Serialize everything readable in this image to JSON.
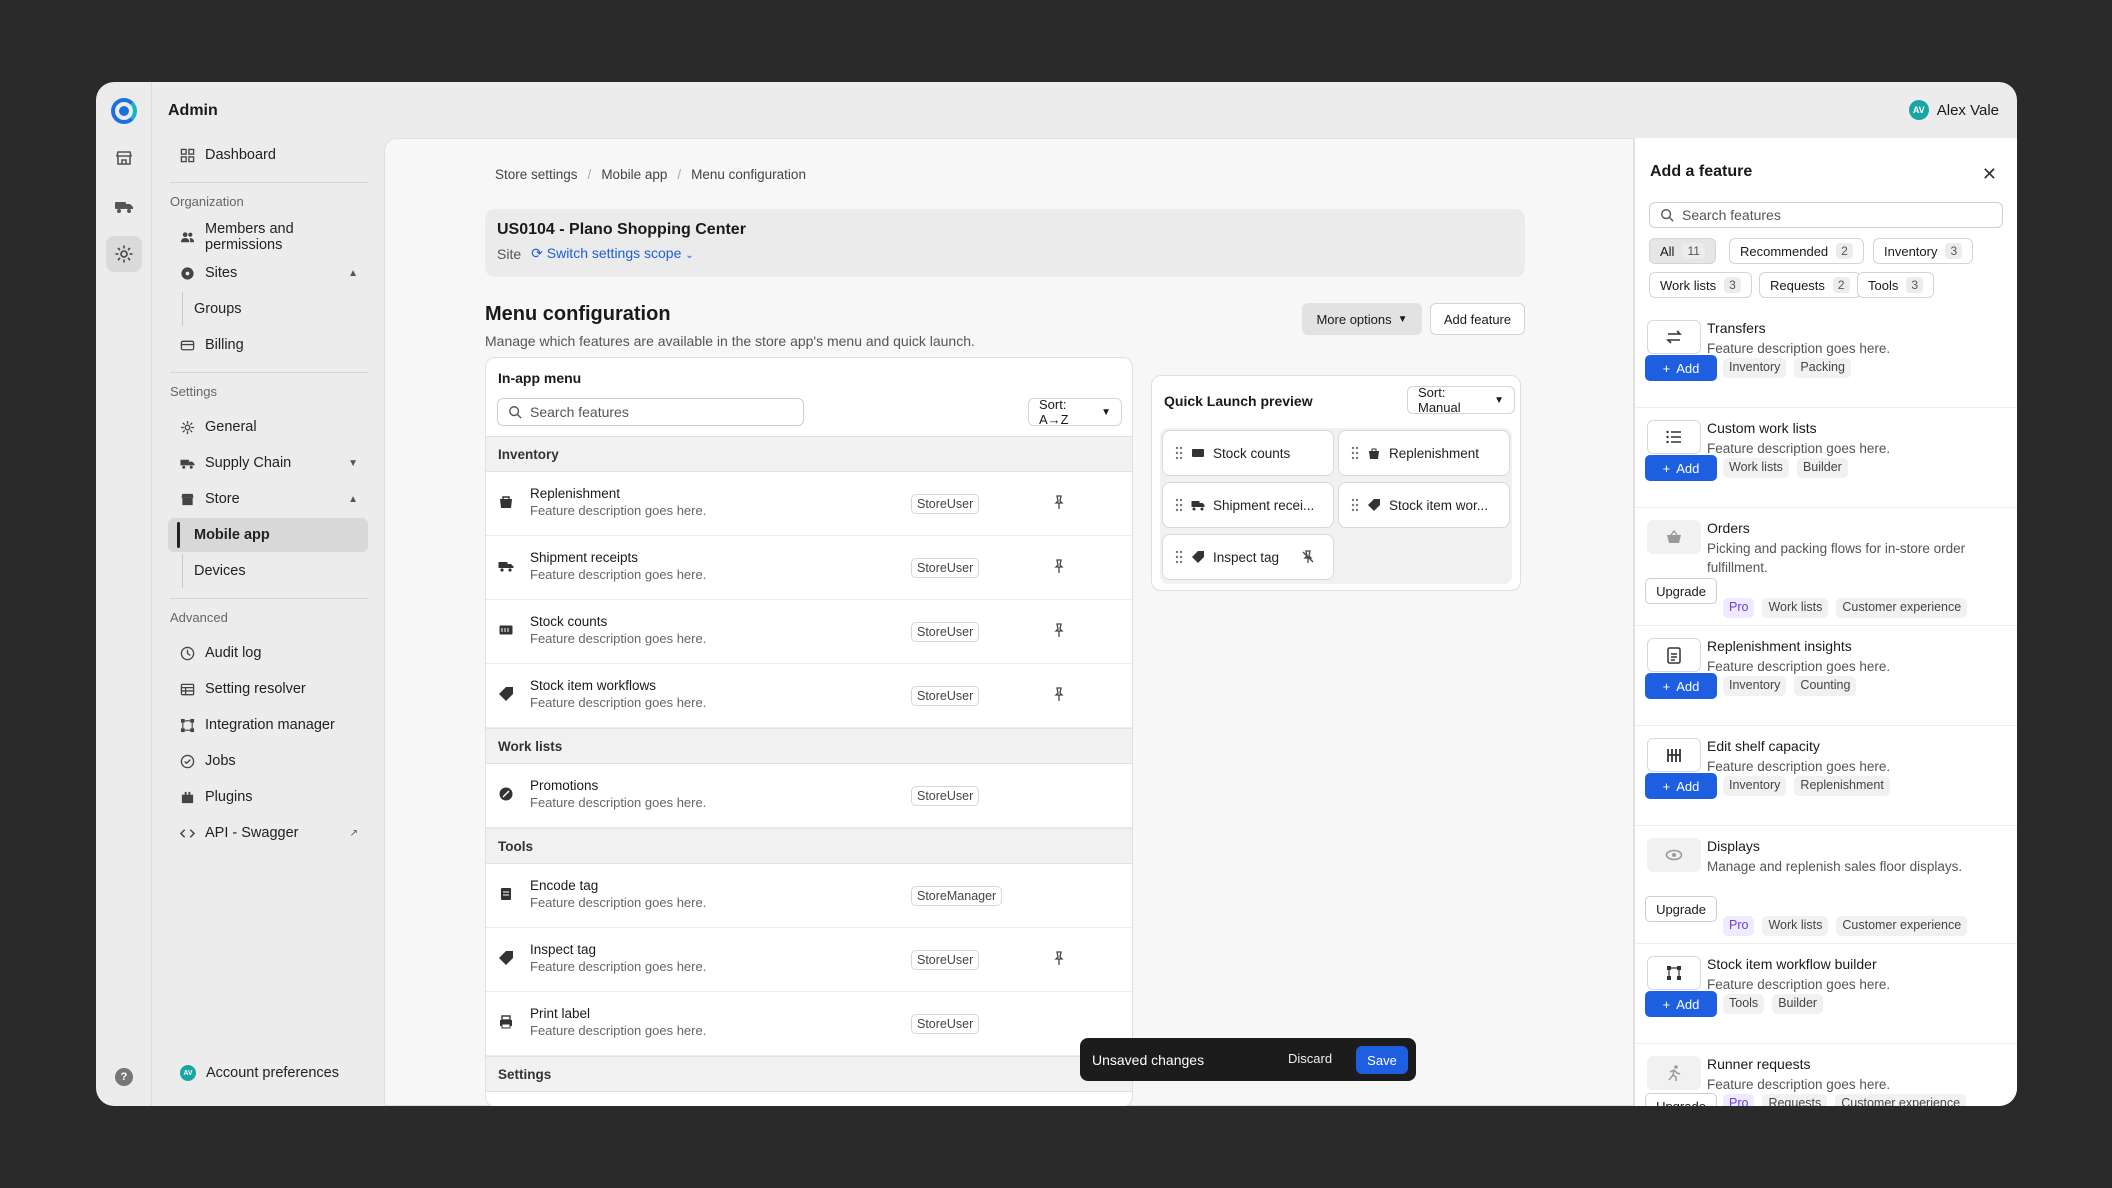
{
  "app": {
    "title": "Admin",
    "user_name": "Alex Vale",
    "user_initials": "AV"
  },
  "nav": {
    "dashboard": "Dashboard",
    "sec_org": "Organization",
    "members": "Members and permissions",
    "sites": "Sites",
    "groups": "Groups",
    "billing": "Billing",
    "sec_settings": "Settings",
    "general": "General",
    "supply_chain": "Supply Chain",
    "store": "Store",
    "mobile_app": "Mobile app",
    "devices": "Devices",
    "sec_advanced": "Advanced",
    "audit_log": "Audit log",
    "setting_resolver": "Setting resolver",
    "integration_manager": "Integration manager",
    "jobs": "Jobs",
    "plugins": "Plugins",
    "api": "API - Swagger",
    "account": "Account preferences",
    "account_initials": "AV"
  },
  "breadcrumbs": [
    "Store settings",
    "Mobile app",
    "Menu configuration"
  ],
  "scope": {
    "title": "US0104 - Plano Shopping Center",
    "label": "Site",
    "link": "Switch settings scope"
  },
  "page": {
    "title": "Menu configuration",
    "desc": "Manage which features are available in the store app's menu and quick launch.",
    "more_options": "More options",
    "add_feature": "Add feature"
  },
  "inapp": {
    "title": "In-app menu",
    "search_placeholder": "Search features",
    "sort": "Sort: A→Z",
    "sections": [
      {
        "name": "Inventory",
        "rows": [
          {
            "name": "Replenishment",
            "desc": "Feature description goes here.",
            "role": "StoreUser",
            "pinned": true
          },
          {
            "name": "Shipment receipts",
            "desc": "Feature description goes here.",
            "role": "StoreUser",
            "pinned": true
          },
          {
            "name": "Stock counts",
            "desc": "Feature description goes here.",
            "role": "StoreUser",
            "pinned": true
          },
          {
            "name": "Stock item workflows",
            "desc": "Feature description goes here.",
            "role": "StoreUser",
            "pinned": true
          }
        ]
      },
      {
        "name": "Work lists",
        "rows": [
          {
            "name": "Promotions",
            "desc": "Feature description goes here.",
            "role": "StoreUser",
            "pinned": false
          }
        ]
      },
      {
        "name": "Tools",
        "rows": [
          {
            "name": "Encode tag",
            "desc": "Feature description goes here.",
            "role": "StoreManager",
            "pinned": false
          },
          {
            "name": "Inspect tag",
            "desc": "Feature description goes here.",
            "role": "StoreUser",
            "pinned": true
          },
          {
            "name": "Print label",
            "desc": "Feature description goes here.",
            "role": "StoreUser",
            "pinned": false
          }
        ]
      },
      {
        "name": "Settings",
        "rows": []
      }
    ]
  },
  "quick_launch": {
    "title": "Quick Launch preview",
    "sort": "Sort: Manual",
    "tiles": [
      "Stock counts",
      "Replenishment",
      "Shipment recei...",
      "Stock item wor...",
      "Inspect tag"
    ]
  },
  "drawer": {
    "title": "Add a feature",
    "search_placeholder": "Search features",
    "filters": [
      {
        "label": "All",
        "count": "11"
      },
      {
        "label": "Recommended",
        "count": "2"
      },
      {
        "label": "Inventory",
        "count": "3"
      },
      {
        "label": "Work lists",
        "count": "3"
      },
      {
        "label": "Requests",
        "count": "2"
      },
      {
        "label": "Tools",
        "count": "3"
      }
    ],
    "add_label": "Add",
    "upgrade_label": "Upgrade",
    "features": [
      {
        "name": "Transfers",
        "desc": "Feature description goes here.",
        "action": "add",
        "tags": [
          "Inventory",
          "Packing"
        ]
      },
      {
        "name": "Custom work lists",
        "desc": "Feature description goes here.",
        "action": "add",
        "tags": [
          "Work lists",
          "Builder"
        ]
      },
      {
        "name": "Orders",
        "desc": "Picking and packing flows for in-store order fulfillment.",
        "action": "upgrade",
        "tags": [
          "Pro",
          "Work lists",
          "Customer experience"
        ]
      },
      {
        "name": "Replenishment insights",
        "desc": "Feature description goes here.",
        "action": "add",
        "tags": [
          "Inventory",
          "Counting"
        ]
      },
      {
        "name": "Edit shelf capacity",
        "desc": "Feature description goes here.",
        "action": "add",
        "tags": [
          "Inventory",
          "Replenishment"
        ]
      },
      {
        "name": "Displays",
        "desc": "Manage and replenish sales floor displays.",
        "action": "upgrade",
        "tags": [
          "Pro",
          "Work lists",
          "Customer experience"
        ]
      },
      {
        "name": "Stock item workflow builder",
        "desc": "Feature description goes here.",
        "action": "add",
        "tags": [
          "Tools",
          "Builder"
        ]
      },
      {
        "name": "Runner requests",
        "desc": "Feature description goes here.",
        "action": "upgrade",
        "tags": [
          "Pro",
          "Requests",
          "Customer experience"
        ]
      }
    ]
  },
  "toast": {
    "message": "Unsaved changes",
    "discard": "Discard",
    "save": "Save"
  },
  "colors": {
    "accent": "#1d5fe0",
    "pro": "#6b3fd6"
  }
}
